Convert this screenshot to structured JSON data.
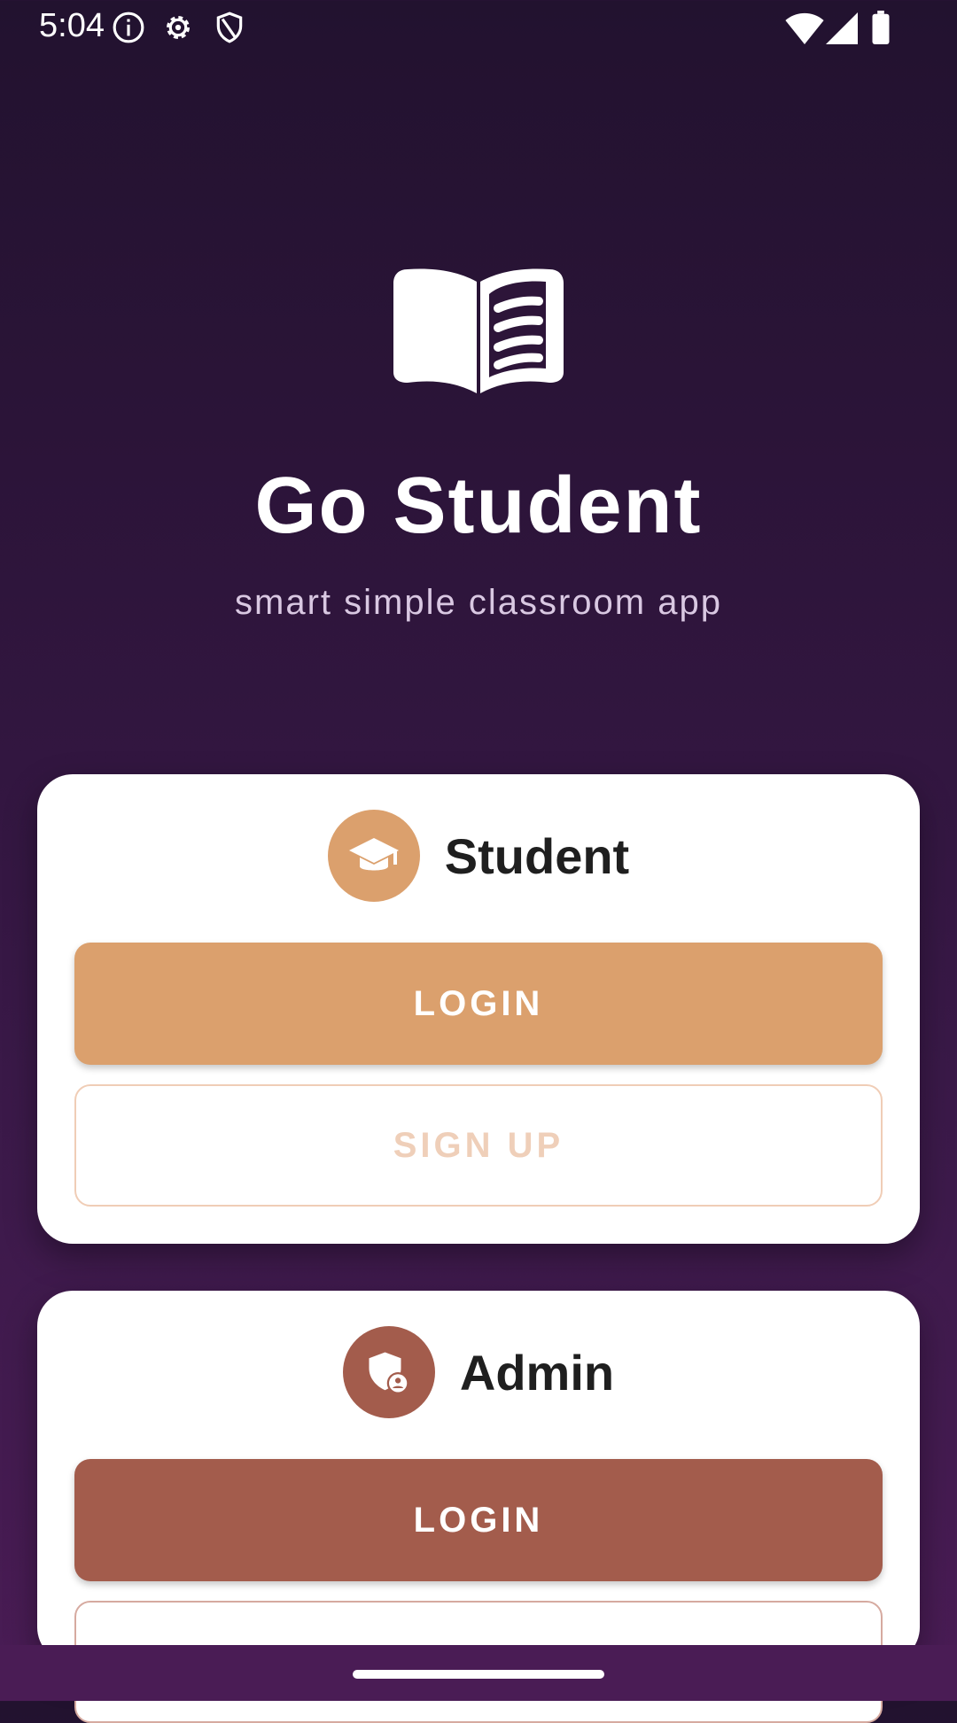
{
  "status_bar": {
    "time": "5:04",
    "left_icons": [
      "info-icon",
      "gear-icon",
      "shield-icon"
    ],
    "right_icons": [
      "wifi-icon",
      "signal-icon",
      "battery-icon"
    ]
  },
  "header": {
    "logo_icon": "open-book-icon",
    "title": "Go Student",
    "subtitle": "smart simple classroom app"
  },
  "cards": {
    "student": {
      "label": "Student",
      "icon": "graduation-cap-icon",
      "accent": "#dba06d",
      "login_label": "LOGIN",
      "signup_label": "SIGN UP"
    },
    "admin": {
      "label": "Admin",
      "icon": "admin-shield-icon",
      "accent": "#a35c4c",
      "login_label": "LOGIN"
    }
  },
  "colors": {
    "background_top": "#22122f",
    "background_bottom": "#4a1c55",
    "card": "#ffffff"
  }
}
